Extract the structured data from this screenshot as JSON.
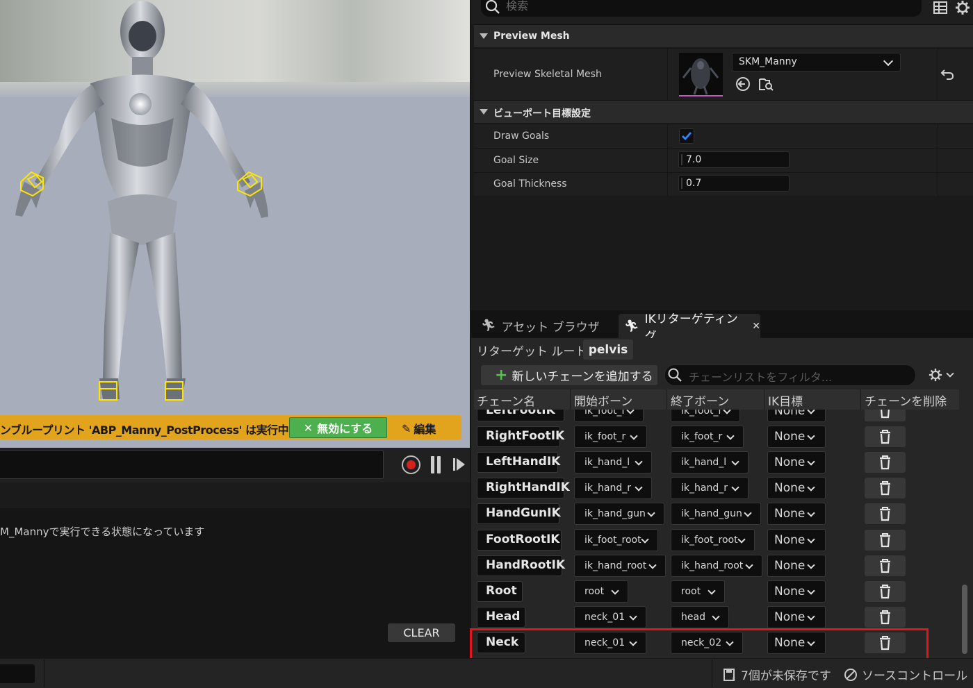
{
  "viewport": {
    "warning_text": "ンブループリント 'ABP_Manny_PostProcess' は実行中",
    "disable_label": "無効にする",
    "edit_label": "編集"
  },
  "log": {
    "message": "M_Mannyで実行できる状態になっています",
    "clear_label": "CLEAR"
  },
  "statusbar": {
    "unsaved": "7個が未保存です",
    "source_control": "ソースコントロール"
  },
  "details": {
    "search_placeholder": "検索",
    "sections": {
      "preview_mesh": "Preview Mesh",
      "viewport_goals": "ビューポート目標設定"
    },
    "preview_skeletal_mesh_label": "Preview Skeletal Mesh",
    "preview_skeletal_mesh_value": "SKM_Manny",
    "draw_goals_label": "Draw Goals",
    "draw_goals_checked": true,
    "goal_size_label": "Goal Size",
    "goal_size_value": "7.0",
    "goal_thickness_label": "Goal Thickness",
    "goal_thickness_value": "0.7"
  },
  "tabs": {
    "asset_browser": "アセット ブラウザ",
    "ik_retargeting": "IKリターゲティング"
  },
  "ik": {
    "root_label": "リターゲット ルート:",
    "root_value": "pelvis",
    "add_chain_label": "新しいチェーンを追加する",
    "filter_placeholder": "チェーンリストをフィルタ...",
    "columns": [
      "チェーン名",
      "開始ボーン",
      "終了ボーン",
      "IK目標",
      "チェーンを削除"
    ],
    "chains": [
      {
        "name": "LeftFootIK",
        "start": "ik_foot_l",
        "end": "ik_foot_l",
        "goal": "None"
      },
      {
        "name": "RightFootIK",
        "start": "ik_foot_r",
        "end": "ik_foot_r",
        "goal": "None"
      },
      {
        "name": "LeftHandIK",
        "start": "ik_hand_l",
        "end": "ik_hand_l",
        "goal": "None"
      },
      {
        "name": "RightHandIK",
        "start": "ik_hand_r",
        "end": "ik_hand_r",
        "goal": "None"
      },
      {
        "name": "HandGunIK",
        "start": "ik_hand_gun",
        "end": "ik_hand_gun",
        "goal": "None"
      },
      {
        "name": "FootRootIK",
        "start": "ik_foot_root",
        "end": "ik_foot_root",
        "goal": "None"
      },
      {
        "name": "HandRootIK",
        "start": "ik_hand_root",
        "end": "ik_hand_root",
        "goal": "None"
      },
      {
        "name": "Root",
        "start": "root",
        "end": "root",
        "goal": "None"
      },
      {
        "name": "Head",
        "start": "neck_01",
        "end": "head",
        "goal": "None"
      },
      {
        "name": "Neck",
        "start": "neck_01",
        "end": "neck_02",
        "goal": "None"
      }
    ],
    "highlighted_chain": "Neck"
  },
  "colors": {
    "warning_bar": "#e3a41d",
    "disable_button": "#4bb04d",
    "checkbox_accent": "#2f87ff",
    "highlight_border": "#e3151e",
    "ik_goal_marker": "#ffe600"
  }
}
